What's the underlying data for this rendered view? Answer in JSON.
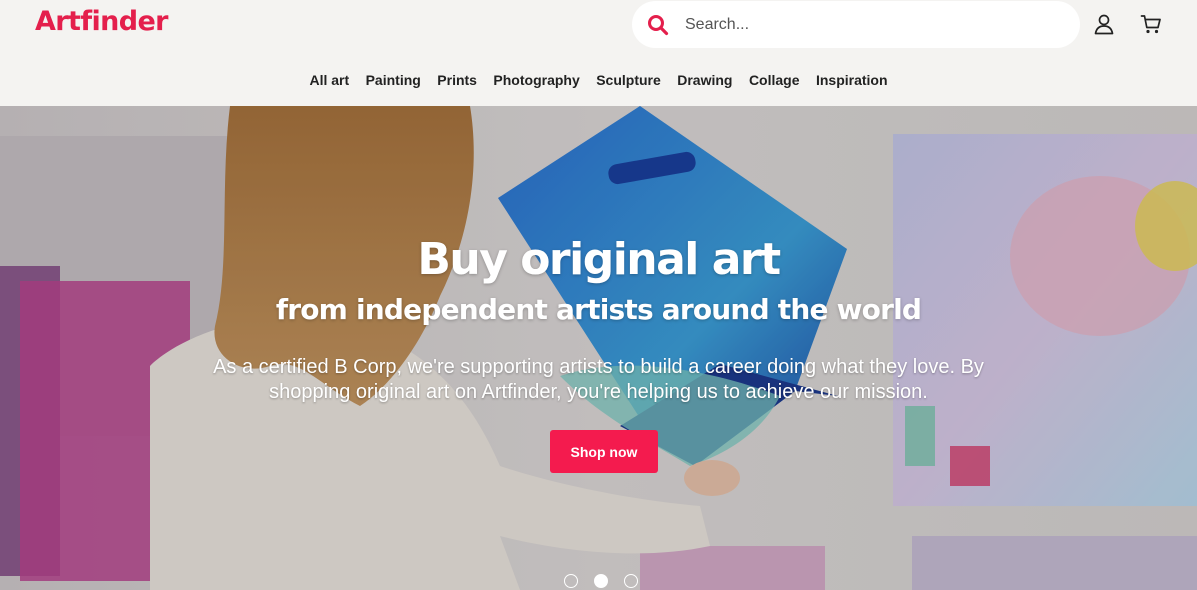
{
  "header": {
    "logo": "Artfinder",
    "search": {
      "placeholder": "Search...",
      "value": "",
      "icon": "search-icon"
    },
    "account_icon": "user-icon",
    "cart_icon": "cart-icon"
  },
  "nav": {
    "items": [
      {
        "label": "All art"
      },
      {
        "label": "Painting"
      },
      {
        "label": "Prints"
      },
      {
        "label": "Photography"
      },
      {
        "label": "Sculpture"
      },
      {
        "label": "Drawing"
      },
      {
        "label": "Collage"
      },
      {
        "label": "Inspiration"
      }
    ]
  },
  "hero": {
    "title": "Buy original art",
    "subtitle": "from independent artists around the world",
    "text": "As a certified B Corp, we're supporting artists to build a career doing what they love. By shopping original art on Artfinder, you're helping us to achieve our mission.",
    "cta_label": "Shop now",
    "carousel": {
      "slides": 3,
      "active": 2
    }
  },
  "colors": {
    "brand": "#e41f4c",
    "cta": "#f41b4e",
    "header_bg": "#f4f3f1"
  }
}
